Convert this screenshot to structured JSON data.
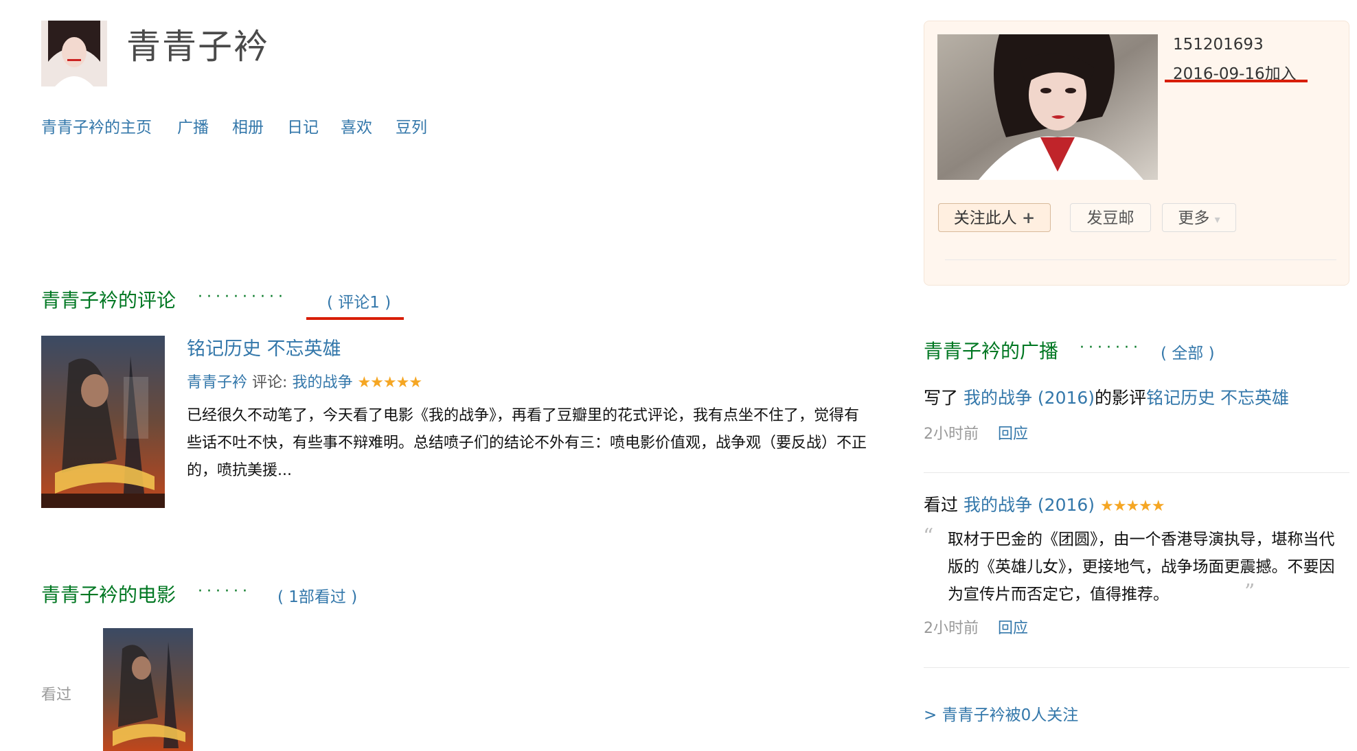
{
  "header": {
    "title": "青青子衿",
    "nav": [
      "青青子衿的主页",
      "广播",
      "相册",
      "日记",
      "喜欢",
      "豆列"
    ]
  },
  "reviews_section": {
    "title": "青青子衿的评论",
    "dots": "··········",
    "paren_open": "(",
    "count_link": "评论1",
    "paren_close": ")",
    "review": {
      "title": "铭记历史 不忘英雄",
      "author": "青青子衿",
      "label": "评论:",
      "movie": "我的战争",
      "rating_stars": 5,
      "stars": "★★★★★",
      "body": "已经很久不动笔了，今天看了电影《我的战争》，再看了豆瓣里的花式评论，我有点坐不住了，觉得有些话不吐不快，有些事不辩难明。总结喷子们的结论不外有三：喷电影价值观，战争观（要反战）不正的，喷抗美援..."
    }
  },
  "movies_section": {
    "title": "青青子衿的电影",
    "dots": "······",
    "paren_open": "(",
    "count_link": "1部看过",
    "paren_close": ")",
    "seen_label": "看过"
  },
  "profile": {
    "user_id": "151201693",
    "join_date": "2016-09-16加入",
    "follow_button": "关注此人",
    "follow_icon": "+",
    "mail_button": "发豆邮",
    "more_button": "更多",
    "more_icon": "▾"
  },
  "broadcast_section": {
    "title": "青青子衿的广播",
    "dots": "·······",
    "paren_open": "(",
    "all_link": "全部",
    "paren_close": ")",
    "item1": {
      "verb": "写了",
      "movie_link": "我的战争 (2016)",
      "middle": "的影评",
      "review_link": "铭记历史 不忘英雄",
      "time": "2小时前",
      "reply": "回应"
    },
    "item2": {
      "verb": "看过",
      "movie_link": "我的战争 (2016)",
      "stars": "★★★★★",
      "rating_stars": 5,
      "quote": "取材于巴金的《团圆》，由一个香港导演执导，堪称当代版的《英雄儿女》，更接地气，战争场面更震撼。不要因为宣传片而否定它，值得推荐。",
      "time": "2小时前",
      "reply": "回应"
    }
  },
  "followers_link": "> 青青子衿被0人关注",
  "colors": {
    "link": "#3377aa",
    "heading_green": "#007722",
    "accent_red": "#d81e06",
    "star": "#f5a623",
    "card_bg": "#fff6ee"
  }
}
